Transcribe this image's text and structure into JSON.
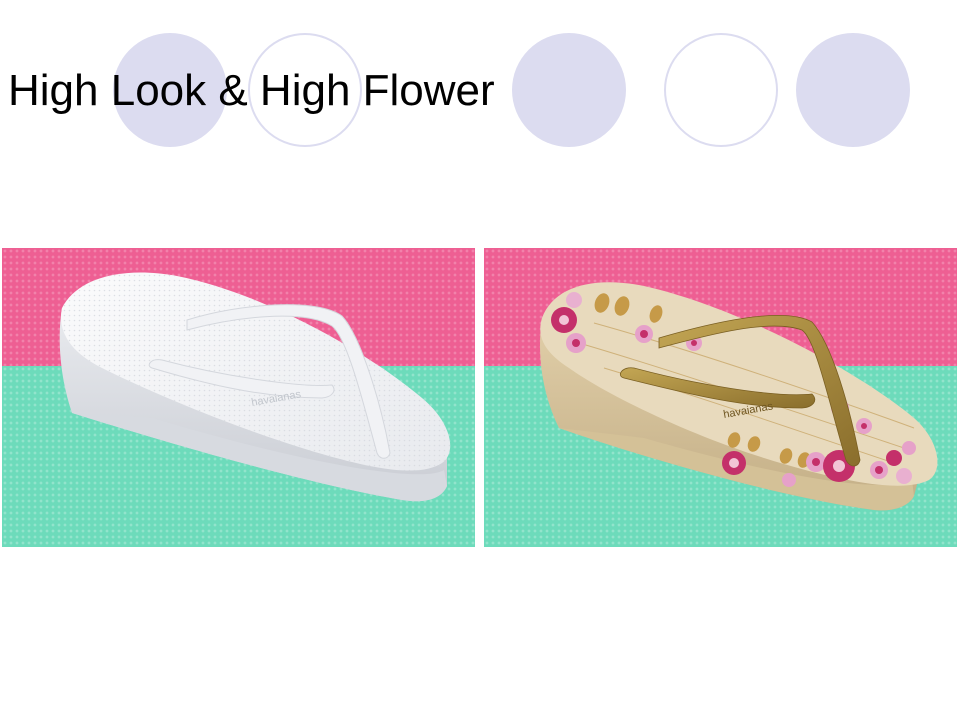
{
  "slide": {
    "title": "High Look & High Flower"
  },
  "images": [
    {
      "brand_text": "havaianas"
    },
    {
      "brand_text": "havaianas"
    }
  ],
  "colors": {
    "circle_fill": "#dcdcf0",
    "backdrop_pink": "#ee5f93",
    "backdrop_green": "#6ddbbb",
    "sandal_white": "#f4f5f7",
    "sandal_beige": "#e6d6b5",
    "strap_gold": "#a88a3e",
    "flower_magenta": "#c4306a"
  }
}
